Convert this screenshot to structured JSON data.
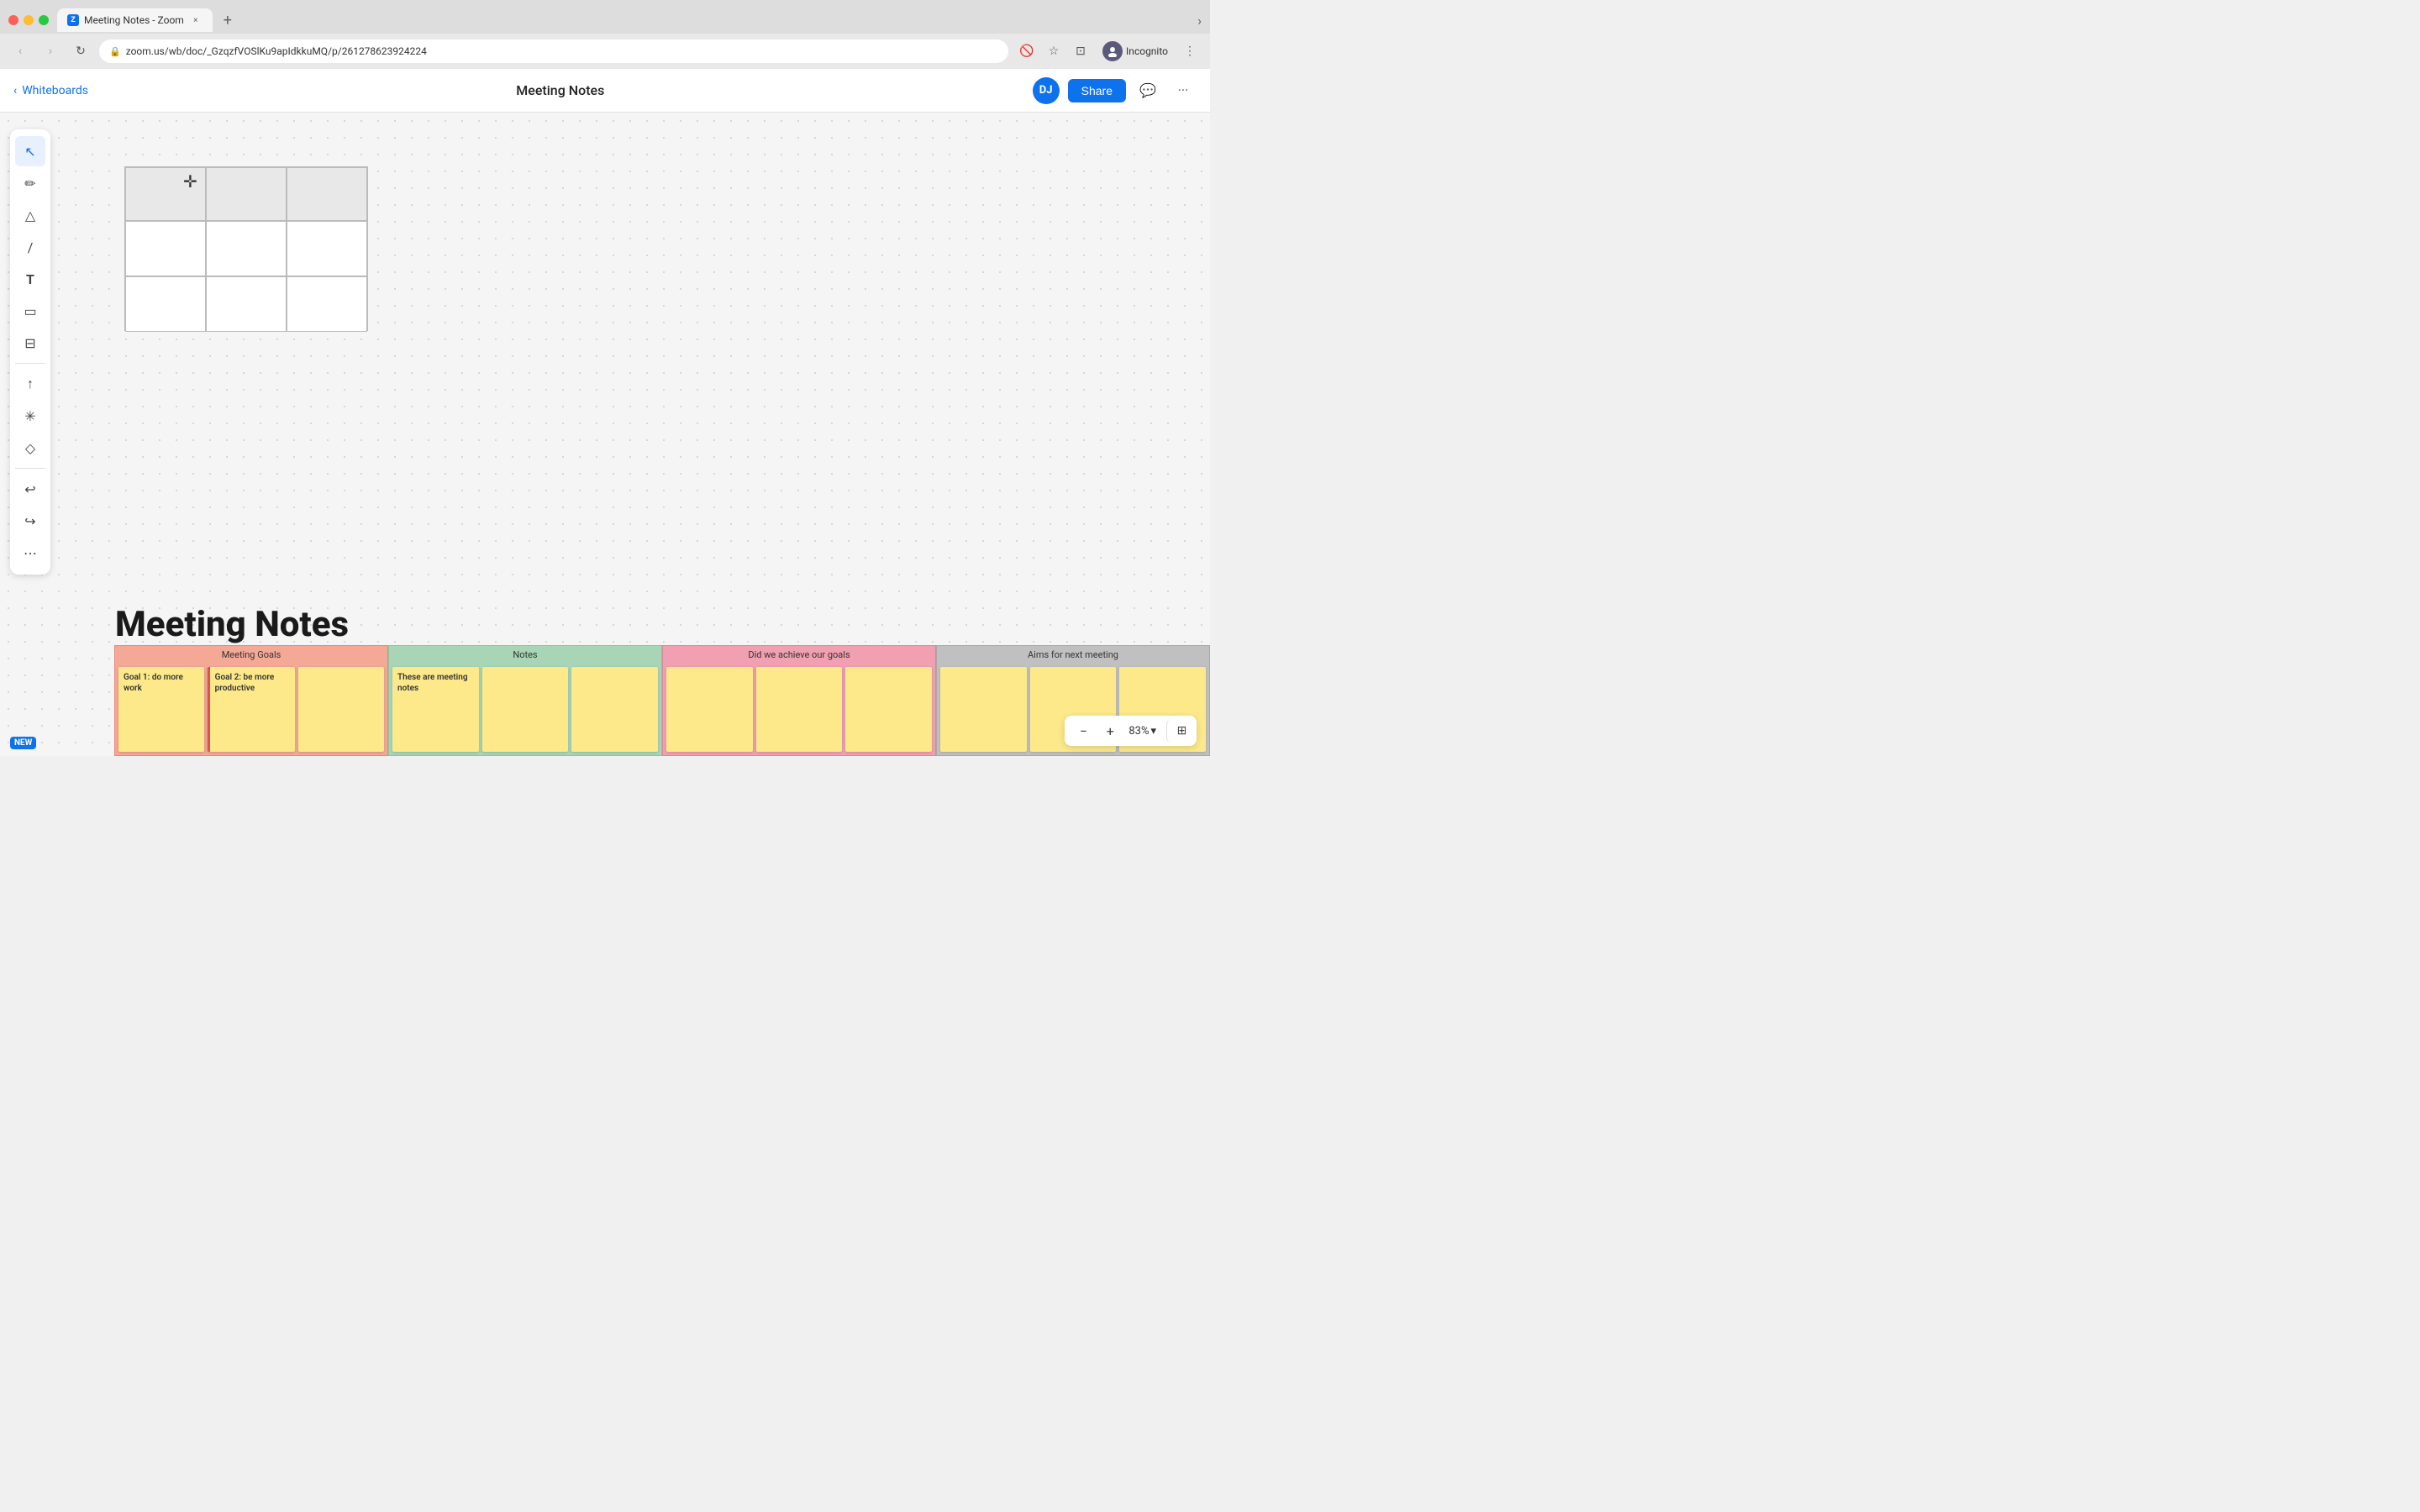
{
  "browser": {
    "traffic_lights": [
      "close",
      "minimize",
      "maximize"
    ],
    "tab": {
      "label": "Meeting Notes - Zoom",
      "favicon": "Z"
    },
    "new_tab_label": "+",
    "nav": {
      "back_label": "‹",
      "forward_label": "›",
      "refresh_label": "↻"
    },
    "url": "zoom.us/wb/doc/_GzqzfVOSlKu9apIdkkuMQ/p/261278623924224",
    "actions": {
      "camera_off": "🚫",
      "bookmark": "☆",
      "split_view": "⊡",
      "incognito_label": "Incognito",
      "more": "⋮",
      "chevron": "›"
    }
  },
  "header": {
    "back_label": "Whiteboards",
    "title": "Meeting Notes",
    "user_initials": "DJ",
    "share_label": "Share",
    "comment_icon": "💬",
    "more_icon": "⋯"
  },
  "toolbar": {
    "tools": [
      {
        "name": "select",
        "icon": "↖",
        "active": true
      },
      {
        "name": "pen",
        "icon": "✏"
      },
      {
        "name": "shape",
        "icon": "△"
      },
      {
        "name": "line",
        "icon": "/"
      },
      {
        "name": "text",
        "icon": "T"
      },
      {
        "name": "frame",
        "icon": "▭"
      },
      {
        "name": "template",
        "icon": "⊟"
      },
      {
        "name": "upload",
        "icon": "↑"
      },
      {
        "name": "smart",
        "icon": "✳"
      },
      {
        "name": "erase",
        "icon": "◇"
      },
      {
        "name": "undo",
        "icon": "↩"
      },
      {
        "name": "redo",
        "icon": "↪"
      },
      {
        "name": "more",
        "icon": "⋯"
      }
    ],
    "new_badge": "NEW"
  },
  "canvas": {
    "table": {
      "rows": 3,
      "cols": 3
    },
    "cursor": "✛",
    "title": "Meeting Notes",
    "board": {
      "sections": [
        {
          "name": "meeting-goals",
          "header": "Meeting Goals",
          "color": "#f4a896",
          "cards": [
            {
              "text": "Goal 1: do more work"
            },
            {
              "text": "Goal 2: be more productive"
            },
            {
              "text": ""
            }
          ]
        },
        {
          "name": "notes",
          "header": "Notes",
          "color": "#a8d5b5",
          "cards": [
            {
              "text": "These are meeting notes"
            },
            {
              "text": ""
            },
            {
              "text": ""
            }
          ]
        },
        {
          "name": "did-we-achieve",
          "header": "Did we achieve our goals",
          "color": "#f0a0b0",
          "cards": [
            {
              "text": ""
            },
            {
              "text": ""
            },
            {
              "text": ""
            }
          ]
        },
        {
          "name": "aims-next",
          "header": "Aims for next meeting",
          "color": "#c8c8c8",
          "cards": [
            {
              "text": ""
            },
            {
              "text": ""
            },
            {
              "text": ""
            }
          ]
        }
      ]
    }
  },
  "zoom": {
    "out_label": "−",
    "in_label": "+",
    "level": "83%",
    "chevron": "▾",
    "apps_icon": "⊞"
  }
}
